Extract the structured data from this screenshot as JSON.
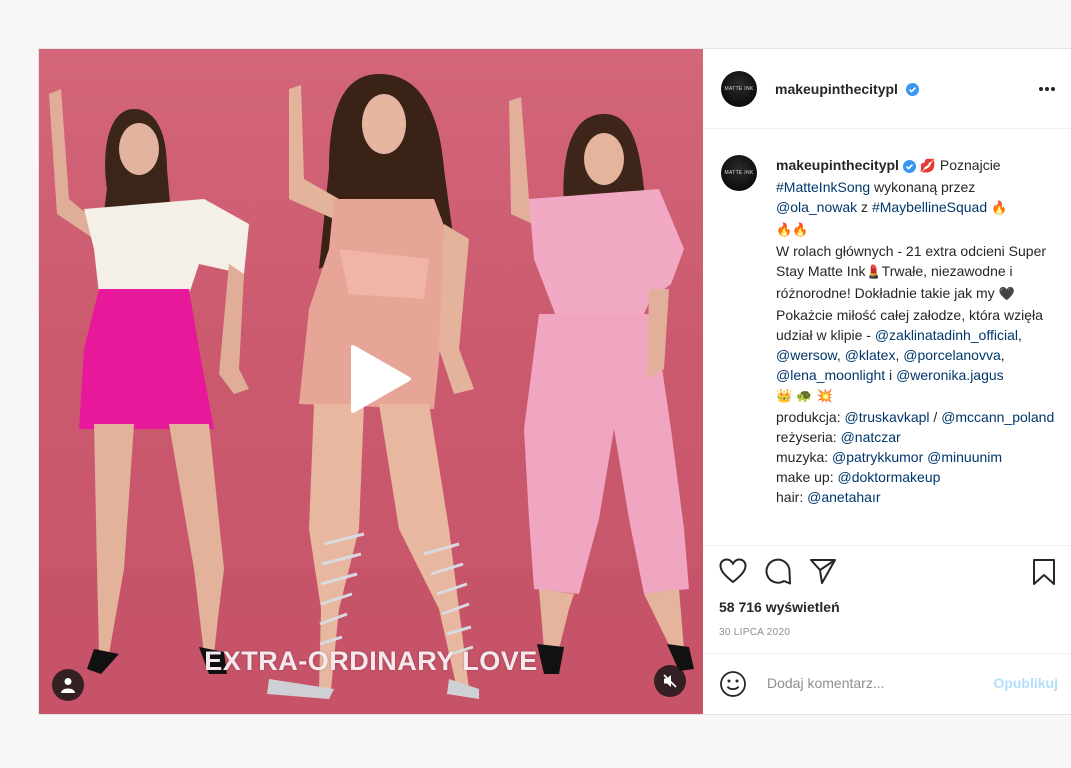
{
  "post": {
    "author": "makeupinthecitypl",
    "avatar_text": "MATTE INK",
    "video_overlay_text": "EXTRA-ORDINARY LOVE",
    "icons": {
      "verified": "verified-badge-icon",
      "more": "more-options-icon",
      "play": "play-icon",
      "user_tag": "user-tag-icon",
      "mute": "speaker-muted-icon",
      "like": "heart-icon",
      "comment": "comment-bubble-icon",
      "share": "paper-plane-icon",
      "save": "bookmark-icon",
      "emoji": "smiley-icon"
    },
    "caption": {
      "emoji_lips": "💋",
      "t1": " Poznajcie ",
      "tag1": "#MatteInkSong",
      "t2": " wykonaną przez ",
      "tag2": "@ola_nowak",
      "t3": " z ",
      "tag3": "#MaybellineSquad",
      "emoji_fire": "🔥",
      "emoji_fire2": "🔥🔥",
      "t4": "W rolach głównych - 21 extra odcieni Super Stay Matte Ink",
      "emoji_lipstick": "💄",
      "t5": "Trwałe, niezawodne i różnorodne! Dokładnie takie jak my ",
      "emoji_heart": "🖤",
      "t6": "Pokażcie miłość całej załodze, która wzięła udział w klipie - ",
      "tag4": "@zaklinatadinh_official",
      "tag5": "@wersow",
      "tag6": "@klatex",
      "tag7": "@porcelanovva",
      "tag8": "@lena_moonlight",
      "t7": " i ",
      "tag9": "@weronika.jagus",
      "emoji_row": "👑 🐢 💥",
      "t8": "produkcja: ",
      "tag10": "@truskavkapl",
      "t8b": " / ",
      "tag11": "@mccann_poland",
      "t9": "reżyseria: ",
      "tag12": "@natczar",
      "t10": "muzyka: ",
      "tag13": "@patrykkumor",
      "tag14": "@minuunim",
      "t11": "make up: ",
      "tag15": "@doktormakeup",
      "t12": "hair: ",
      "tag16": "@anetahaır"
    },
    "views": "58 716 wyświetleń",
    "date": "30 LIPCA 2020",
    "comment_placeholder": "Dodaj komentarz...",
    "publish_label": "Opublikuj",
    "colors": {
      "video_bg": "#cb5a6e",
      "link": "#00376b",
      "publish_disabled": "#b2dffc",
      "verified_blue": "#3897f0"
    }
  }
}
